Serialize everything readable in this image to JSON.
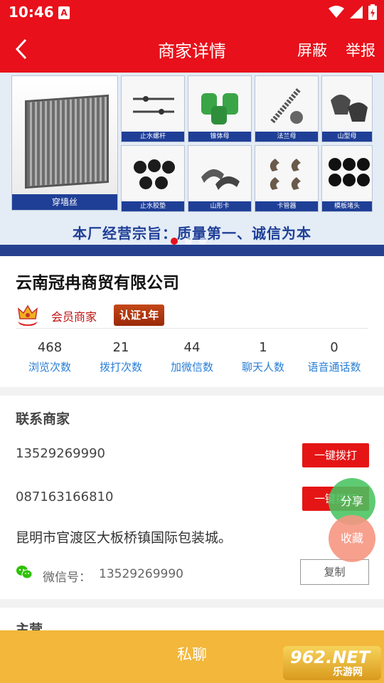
{
  "status_bar": {
    "time": "10:46",
    "notification_badge": "A",
    "icons": [
      "wifi-icon",
      "signal-icon",
      "battery-icon"
    ]
  },
  "nav": {
    "title": "商家详情",
    "block_label": "屏蔽",
    "report_label": "举报"
  },
  "banner": {
    "big_caption": "穿墙丝",
    "tile_captions": [
      "止水螺杆",
      "锥体母",
      "法兰母",
      "山型母",
      "止水胶垫",
      "山形卡",
      "卡管器",
      "模板堵头"
    ],
    "slogan": "本厂经营宗旨：质量第一、诚信为本",
    "slide_count": 3,
    "active_slide": 1
  },
  "company": {
    "name": "云南冠冉商贸有限公司",
    "member_label": "会员商家",
    "cert_label": "认证1年"
  },
  "stats": [
    {
      "value": "468",
      "label": "浏览次数"
    },
    {
      "value": "21",
      "label": "拨打次数"
    },
    {
      "value": "44",
      "label": "加微信数"
    },
    {
      "value": "1",
      "label": "聊天人数"
    },
    {
      "value": "0",
      "label": "语音通话数"
    }
  ],
  "contact": {
    "title": "联系商家",
    "phones": [
      {
        "number": "13529269990",
        "button": "一键拨打"
      },
      {
        "number": "087163166810",
        "button": "一键拨打"
      }
    ],
    "address": "昆明市官渡区大板桥镇国际包装城。",
    "wechat_label": "微信号：",
    "wechat_id": "13529269990",
    "copy_label": "复制"
  },
  "next_section": {
    "title": "主营"
  },
  "floating": {
    "share_label": "分享",
    "favorite_label": "收藏"
  },
  "bottom": {
    "chat_label": "私聊"
  },
  "watermark": {
    "brand": "962.NET",
    "sub": "乐游网"
  },
  "colors": {
    "primary_red": "#e8101a",
    "link_blue": "#2a7fd6",
    "chat_yellow": "#f2b73b",
    "share_green": "#48c460",
    "favorite_pink": "#f69682"
  }
}
